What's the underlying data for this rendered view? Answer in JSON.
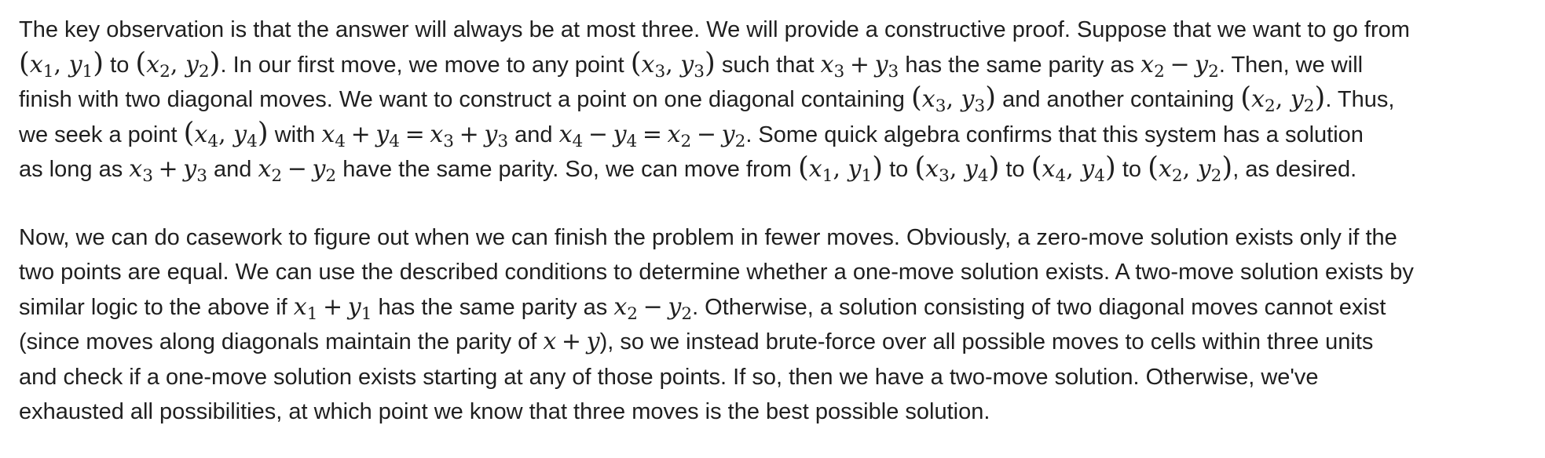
{
  "paragraph1": {
    "lines": [
      "The key observation is that the answer will always be at most three. We will provide a constructive proof. Suppose that we want to go from",
      "(x_1, y_1) to (x_2, y_2). In our first move, we move to any point (x_3, y_3) such that x_3 + y_3 has the same parity as x_2 − y_2. Then, we will",
      "finish with two diagonal moves. We want to construct a point on one diagonal containing (x_3, y_3) and another containing (x_2, y_2). Thus,",
      "we seek a point (x_4, y_4) with x_4 + y_4 = x_3 + y_3 and x_4 − y_4 = x_2 − y_2. Some quick algebra confirms that this system has a solution",
      "as long as x_3 + y_3 and x_2 − y_2 have the same parity. So, we can move from (x_1, y_1) to (x_3, y_4) to (x_4, y_4) to (x_2, y_2), as desired."
    ]
  },
  "paragraph2": {
    "lines": [
      "Now, we can do casework to figure out when we can finish the problem in fewer moves. Obviously, a zero-move solution exists only if the",
      "two points are equal. We can use the described conditions to determine whether a one-move solution exists. A two-move solution exists by",
      "similar logic to the above if x_1 + y_1 has the same parity as x_2 − y_2. Otherwise, a solution consisting of two diagonal moves cannot exist",
      "(since moves along diagonals maintain the parity of x + y), so we instead brute-force over all possible moves to cells within three units",
      "and check if a one-move solution exists starting at any of those points. If so, then we have a two-move solution. Otherwise, we've",
      "exhausted all possibilities, at which point we know that three moves is the best possible solution."
    ]
  }
}
